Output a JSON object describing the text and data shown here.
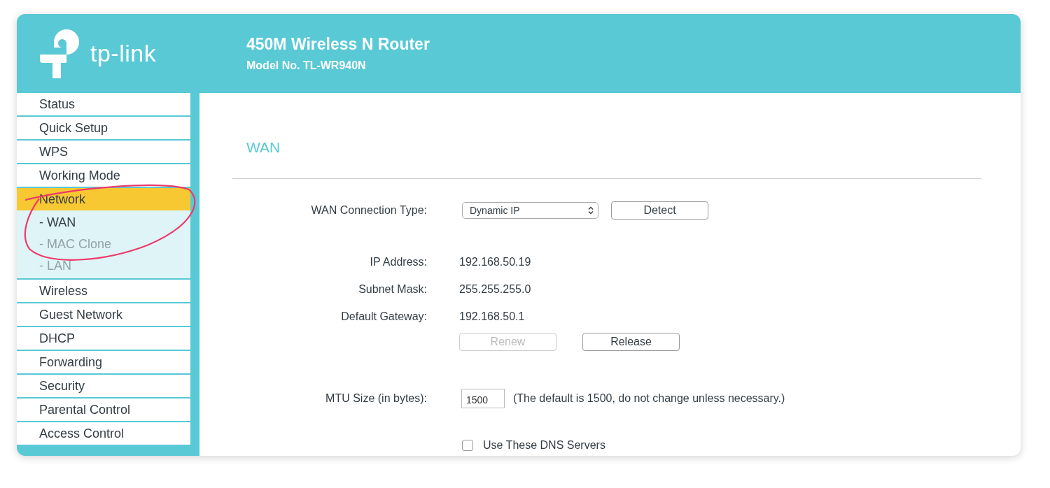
{
  "header": {
    "logo": "tp-link",
    "title": "450M Wireless N Router",
    "model": "Model No. TL-WR940N"
  },
  "sidebar": {
    "items": [
      {
        "label": "Status",
        "selected": false
      },
      {
        "label": "Quick Setup",
        "selected": false
      },
      {
        "label": "WPS",
        "selected": false
      },
      {
        "label": "Working Mode",
        "selected": false
      },
      {
        "label": "Network",
        "selected": true,
        "children": [
          {
            "label": "- WAN",
            "selected": true
          },
          {
            "label": "- MAC Clone",
            "selected": false
          },
          {
            "label": "- LAN",
            "selected": false
          }
        ]
      },
      {
        "label": "Wireless",
        "selected": false
      },
      {
        "label": "Guest Network",
        "selected": false
      },
      {
        "label": "DHCP",
        "selected": false
      },
      {
        "label": "Forwarding",
        "selected": false
      },
      {
        "label": "Security",
        "selected": false
      },
      {
        "label": "Parental Control",
        "selected": false
      },
      {
        "label": "Access Control",
        "selected": false
      }
    ]
  },
  "page": {
    "title": "WAN",
    "connection_type": {
      "label": "WAN Connection Type:",
      "value": "Dynamic IP",
      "button": "Detect"
    },
    "info": [
      {
        "label": "IP Address:",
        "value": "192.168.50.19"
      },
      {
        "label": "Subnet Mask:",
        "value": "255.255.255.0"
      },
      {
        "label": "Default Gateway:",
        "value": "192.168.50.1"
      }
    ],
    "actions": [
      {
        "label": "Renew",
        "disabled": true
      },
      {
        "label": "Release",
        "disabled": false
      }
    ],
    "mtu": {
      "label": "MTU Size (in bytes):",
      "value": "1500",
      "note": "(The default is 1500, do not change unless necessary.)"
    },
    "dns": {
      "label": "Use These DNS Servers",
      "checked": false
    }
  }
}
